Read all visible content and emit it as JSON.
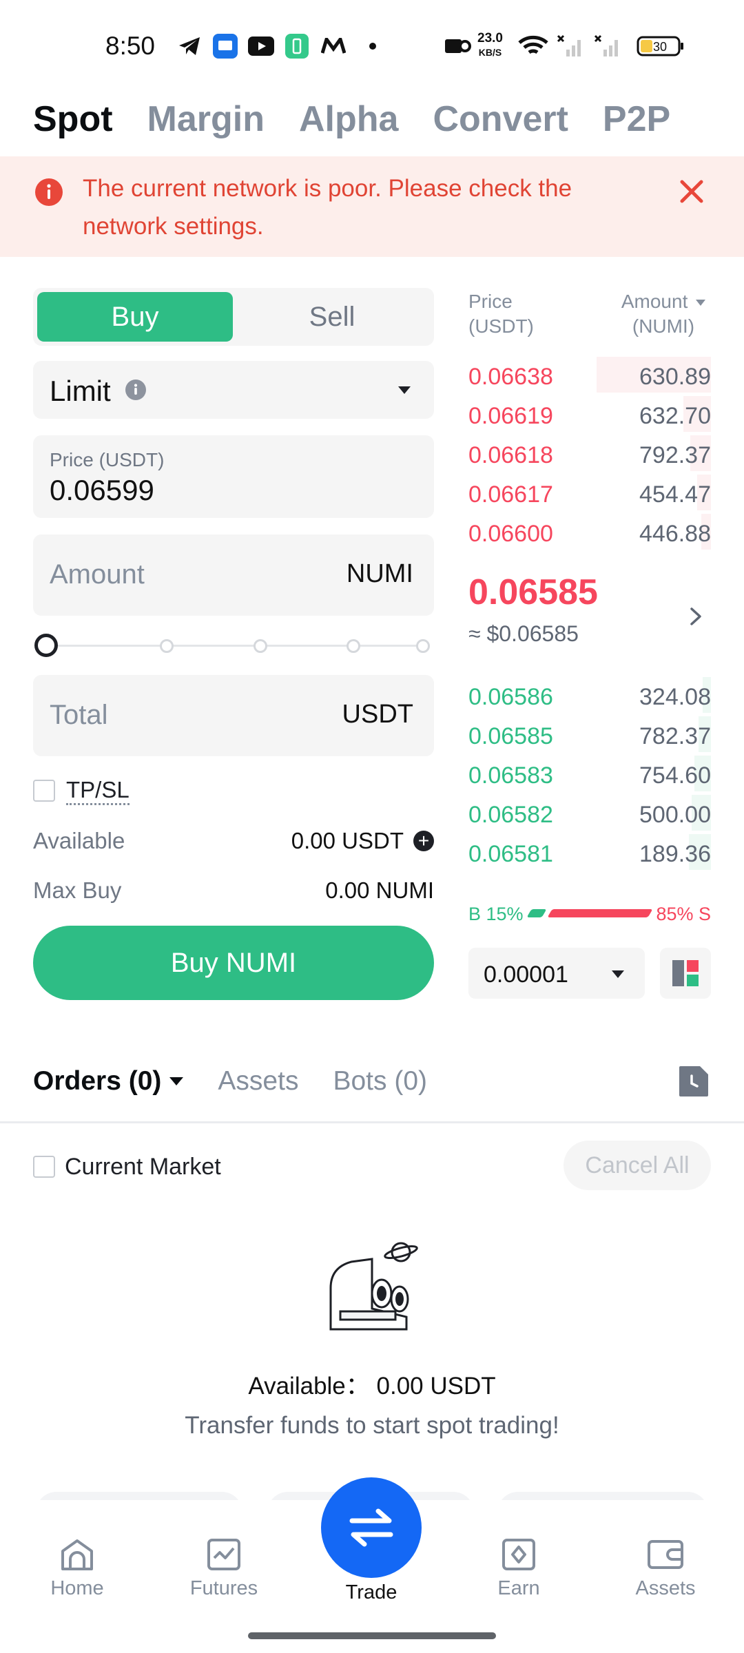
{
  "status_bar": {
    "time": "8:50",
    "net_speed": "23.0",
    "net_unit": "KB/S",
    "battery": "30"
  },
  "top_tabs": [
    "Spot",
    "Margin",
    "Alpha",
    "Convert",
    "P2P"
  ],
  "banner": {
    "message": "The current network is poor. Please check the network settings."
  },
  "form": {
    "buy_label": "Buy",
    "sell_label": "Sell",
    "order_type": "Limit",
    "price_caption": "Price (USDT)",
    "price_value": "0.06599",
    "amount_placeholder": "Amount",
    "amount_unit": "NUMI",
    "slider_percent": 0,
    "total_placeholder": "Total",
    "total_unit": "USDT",
    "tpsl_label": "TP/SL",
    "available_label": "Available",
    "available_value": "0.00 USDT",
    "max_buy_label": "Max Buy",
    "max_buy_value": "0.00 NUMI",
    "submit_label": "Buy NUMI"
  },
  "order_book": {
    "price_header_1": "Price",
    "price_header_2": "(USDT)",
    "amount_header_1": "Amount",
    "amount_header_2": "(NUMI)",
    "asks": [
      {
        "price": "0.06638",
        "amount": "630.89"
      },
      {
        "price": "0.06619",
        "amount": "632.70"
      },
      {
        "price": "0.06618",
        "amount": "792.37"
      },
      {
        "price": "0.06617",
        "amount": "454.47"
      },
      {
        "price": "0.06600",
        "amount": "446.88"
      }
    ],
    "last_price": "0.06585",
    "last_price_usd": "≈ $0.06585",
    "bids": [
      {
        "price": "0.06586",
        "amount": "324.08"
      },
      {
        "price": "0.06585",
        "amount": "782.37"
      },
      {
        "price": "0.06583",
        "amount": "754.60"
      },
      {
        "price": "0.06582",
        "amount": "500.00"
      },
      {
        "price": "0.06581",
        "amount": "189.36"
      }
    ],
    "buy_ratio_label": "B 15%",
    "sell_ratio_label": "85% S",
    "buy_ratio": 0.15,
    "precision": "0.00001"
  },
  "orders": {
    "tabs": [
      "Orders (0)",
      "Assets",
      "Bots (0)"
    ],
    "current_market_label": "Current Market",
    "cancel_all_label": "Cancel All",
    "empty_available": "Available： 0.00 USDT",
    "empty_hint": "Transfer funds to start spot trading!"
  },
  "bottom_nav": [
    "Home",
    "Futures",
    "Trade",
    "Earn",
    "Assets"
  ],
  "colors": {
    "buy_green": "#2ebd85",
    "sell_red": "#f6465d",
    "trade_blue": "#1468f5",
    "banner_bg": "#fdeeeb",
    "banner_text": "#e04434"
  }
}
